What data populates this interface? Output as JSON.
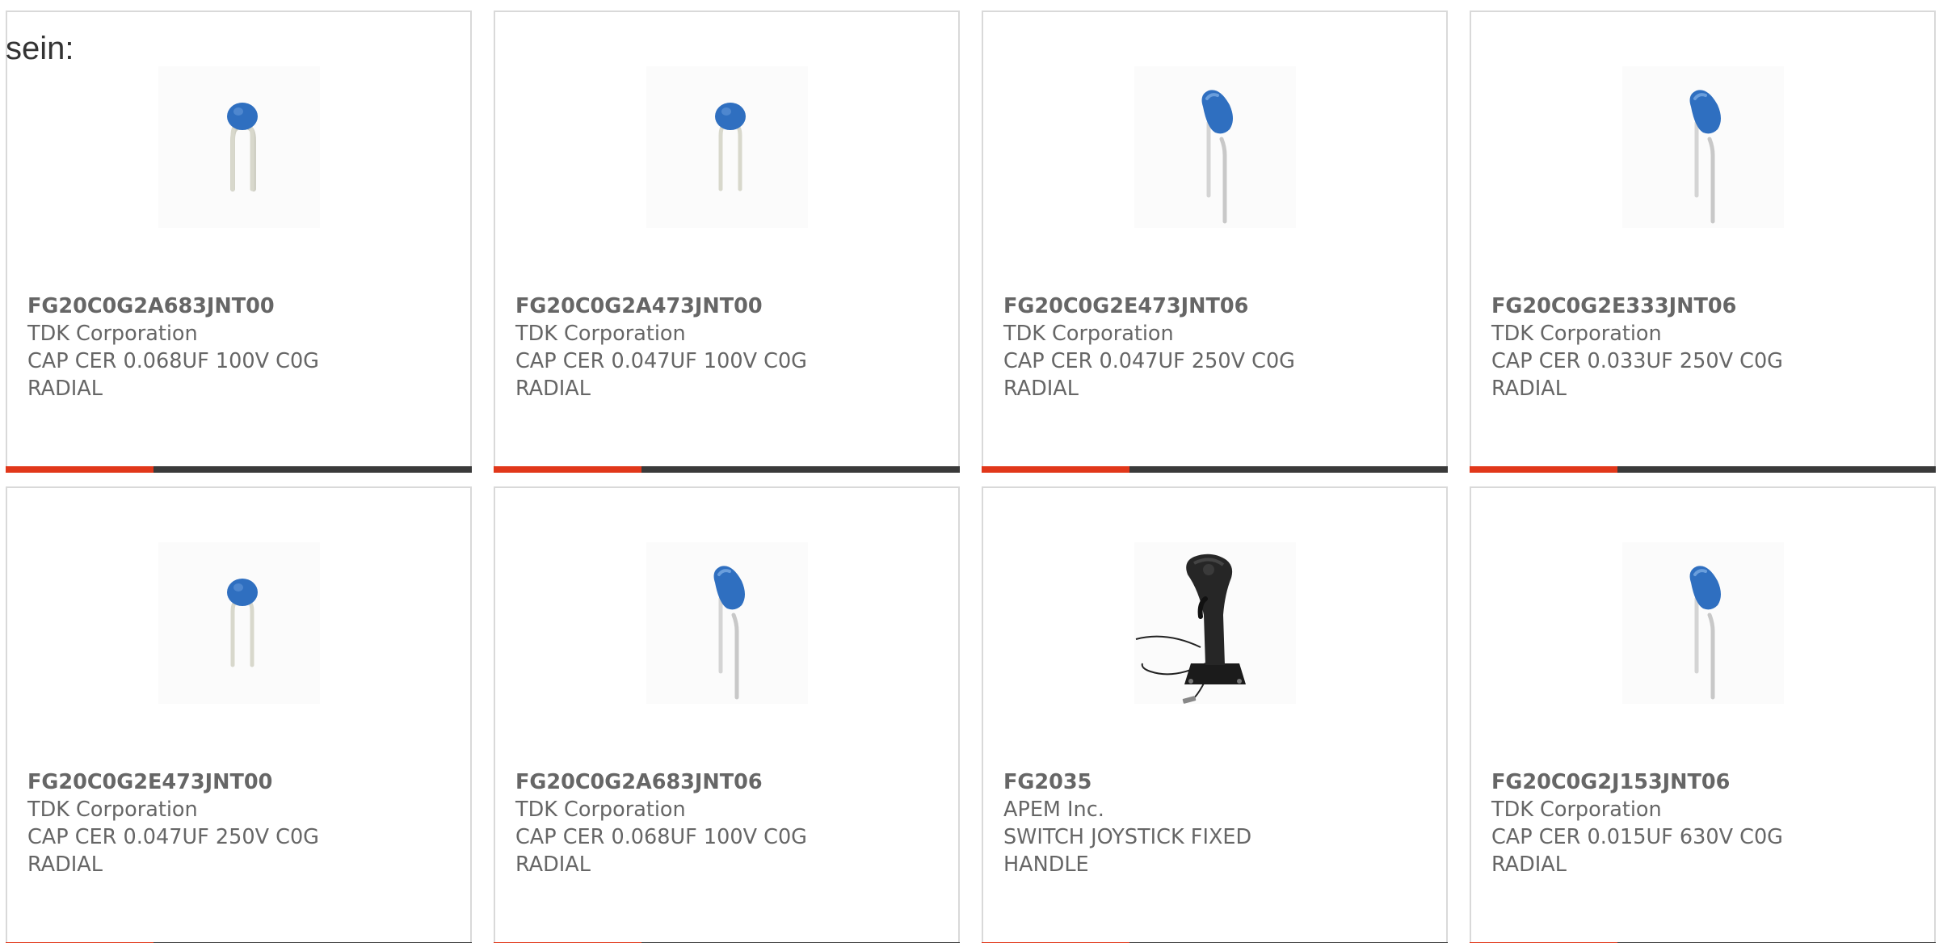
{
  "intro_text": "sein:",
  "colors": {
    "accent": "#e1371a",
    "bar": "#3a3a3a",
    "border": "#d9d9d9",
    "text": "#666666",
    "capacitor_blue": "#2f6fc0"
  },
  "cards": [
    {
      "part_number": "FG20C0G2A683JNT00",
      "manufacturer": "TDK Corporation",
      "desc_line1": "CAP CER 0.068UF 100V C0G",
      "desc_line2": "RADIAL",
      "image": "disc-capacitor-icon"
    },
    {
      "part_number": "FG20C0G2A473JNT00",
      "manufacturer": "TDK Corporation",
      "desc_line1": "CAP CER 0.047UF 100V C0G",
      "desc_line2": "RADIAL",
      "image": "disc-capacitor-icon"
    },
    {
      "part_number": "FG20C0G2E473JNT06",
      "manufacturer": "TDK Corporation",
      "desc_line1": "CAP CER 0.047UF 250V C0G",
      "desc_line2": "RADIAL",
      "image": "tilted-capacitor-icon"
    },
    {
      "part_number": "FG20C0G2E333JNT06",
      "manufacturer": "TDK Corporation",
      "desc_line1": "CAP CER 0.033UF 250V C0G",
      "desc_line2": "RADIAL",
      "image": "tilted-capacitor-icon"
    },
    {
      "part_number": "FG20C0G2E473JNT00",
      "manufacturer": "TDK Corporation",
      "desc_line1": "CAP CER 0.047UF 250V C0G",
      "desc_line2": "RADIAL",
      "image": "disc-capacitor-icon"
    },
    {
      "part_number": "FG20C0G2A683JNT06",
      "manufacturer": "TDK Corporation",
      "desc_line1": "CAP CER 0.068UF 100V C0G",
      "desc_line2": "RADIAL",
      "image": "tilted-capacitor-icon"
    },
    {
      "part_number": "FG2035",
      "manufacturer": "APEM Inc.",
      "desc_line1": "SWITCH JOYSTICK FIXED",
      "desc_line2": "HANDLE",
      "image": "joystick-icon"
    },
    {
      "part_number": "FG20C0G2J153JNT06",
      "manufacturer": "TDK Corporation",
      "desc_line1": "CAP CER 0.015UF 630V C0G",
      "desc_line2": "RADIAL",
      "image": "tilted-capacitor-icon"
    }
  ]
}
